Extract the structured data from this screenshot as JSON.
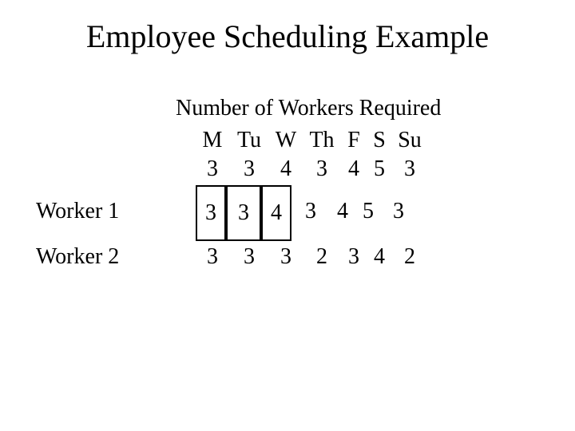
{
  "title": "Employee Scheduling Example",
  "subtitle": "Number of Workers Required",
  "days": {
    "m": "M",
    "tu": "Tu",
    "w": "W",
    "th": "Th",
    "f": "F",
    "s": "S",
    "su": "Su"
  },
  "required": {
    "m": "3",
    "tu": "3",
    "w": "4",
    "th": "3",
    "f": "4",
    "s": "5",
    "su": "3"
  },
  "workers": [
    {
      "label": "Worker 1",
      "m": "3",
      "tu": "3",
      "w": "4",
      "th": "3",
      "f": "4",
      "s": "5",
      "su": "3"
    },
    {
      "label": "Worker 2",
      "m": "3",
      "tu": "3",
      "w": "3",
      "th": "2",
      "f": "3",
      "s": "4",
      "su": "2"
    }
  ]
}
